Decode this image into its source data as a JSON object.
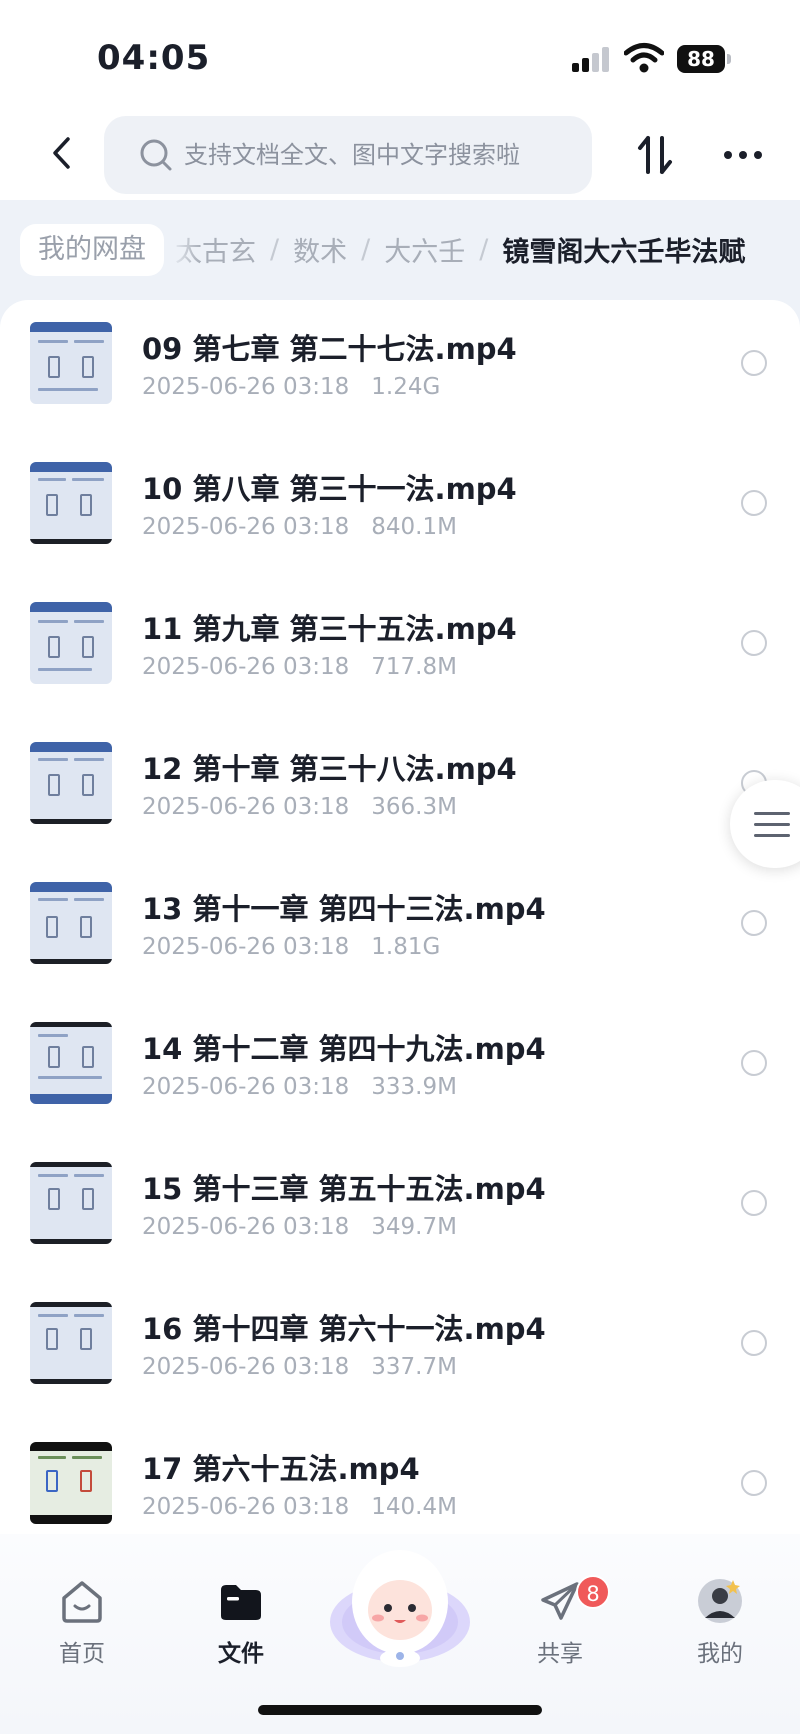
{
  "status_bar": {
    "time": "04:05",
    "battery": "88"
  },
  "header": {
    "search_placeholder": "支持文档全文、图中文字搜索啦",
    "icons": {
      "back": "chevron-left-icon",
      "search": "search-icon",
      "sort": "sort-icon",
      "more": "more-horizontal-icon"
    }
  },
  "breadcrumb": {
    "root": "我的网盘",
    "items": [
      "太古玄",
      "数术",
      "大六壬",
      "镜雪阁大六壬毕法赋"
    ],
    "separator": "/"
  },
  "files": [
    {
      "name": "09 第七章 第二十七法.mp4",
      "date": "2025-06-26 03:18",
      "size": "1.24G"
    },
    {
      "name": "10 第八章 第三十一法.mp4",
      "date": "2025-06-26 03:18",
      "size": "840.1M"
    },
    {
      "name": "11 第九章 第三十五法.mp4",
      "date": "2025-06-26 03:18",
      "size": "717.8M"
    },
    {
      "name": "12 第十章 第三十八法.mp4",
      "date": "2025-06-26 03:18",
      "size": "366.3M"
    },
    {
      "name": "13 第十一章 第四十三法.mp4",
      "date": "2025-06-26 03:18",
      "size": "1.81G"
    },
    {
      "name": "14 第十二章 第四十九法.mp4",
      "date": "2025-06-26 03:18",
      "size": "333.9M"
    },
    {
      "name": "15 第十三章 第五十五法.mp4",
      "date": "2025-06-26 03:18",
      "size": "349.7M"
    },
    {
      "name": "16 第十四章 第六十一法.mp4",
      "date": "2025-06-26 03:18",
      "size": "337.7M"
    },
    {
      "name": "17 第六十五法.mp4",
      "date": "2025-06-26 03:18",
      "size": "140.4M"
    }
  ],
  "bottom_nav": {
    "items": [
      {
        "label": "首页",
        "icon": "home-icon",
        "active": false
      },
      {
        "label": "文件",
        "icon": "folder-icon",
        "active": true
      },
      {
        "label": "共享",
        "icon": "share-icon",
        "active": false,
        "badge": "8"
      },
      {
        "label": "我的",
        "icon": "avatar-icon",
        "active": false
      }
    ]
  },
  "colors": {
    "accent": "#3f63a8",
    "badge": "#f05a5a",
    "text": "#1b1f2a",
    "muted": "#a8aeb8"
  }
}
